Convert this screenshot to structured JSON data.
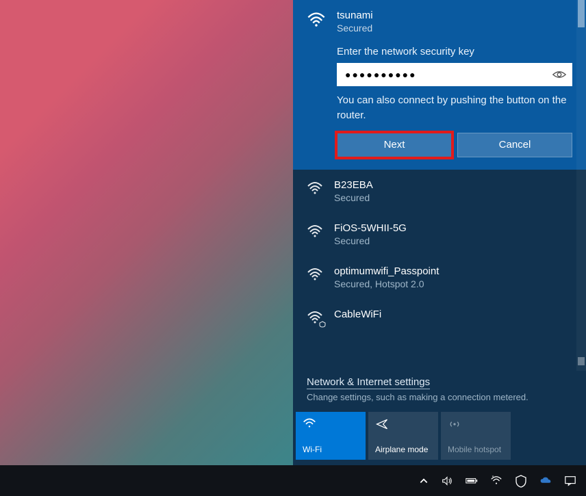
{
  "connecting": {
    "name": "tsunami",
    "status": "Secured",
    "prompt": "Enter the network security key",
    "password_mask": "●●●●●●●●●●",
    "router_hint": "You can also connect by pushing the button on the router.",
    "next_label": "Next",
    "cancel_label": "Cancel"
  },
  "networks": [
    {
      "name": "B23EBA",
      "status": "Secured",
      "icon": "wifi"
    },
    {
      "name": "FiOS-5WHII-5G",
      "status": "Secured",
      "icon": "wifi"
    },
    {
      "name": "optimumwifi_Passpoint",
      "status": "Secured, Hotspot 2.0",
      "icon": "wifi"
    },
    {
      "name": "CableWiFi",
      "status": "",
      "icon": "open-wifi"
    }
  ],
  "settings": {
    "link": "Network & Internet settings",
    "desc": "Change settings, such as making a connection metered."
  },
  "tiles": {
    "wifi": "Wi-Fi",
    "airplane": "Airplane mode",
    "hotspot": "Mobile hotspot"
  },
  "icons": {
    "wifi": "wifi-icon",
    "eye": "eye-icon",
    "shield": "open-wifi-shield-icon",
    "airplane": "airplane-icon",
    "hotspot": "hotspot-icon",
    "chevron_up": "chevron-up-icon",
    "speaker": "speaker-icon",
    "battery": "battery-icon",
    "security": "defender-icon",
    "onedrive": "onedrive-icon",
    "action_center": "action-center-icon"
  },
  "colors": {
    "accent": "#0078d7",
    "panel": "#11324f",
    "highlight": "#e21b1b"
  }
}
